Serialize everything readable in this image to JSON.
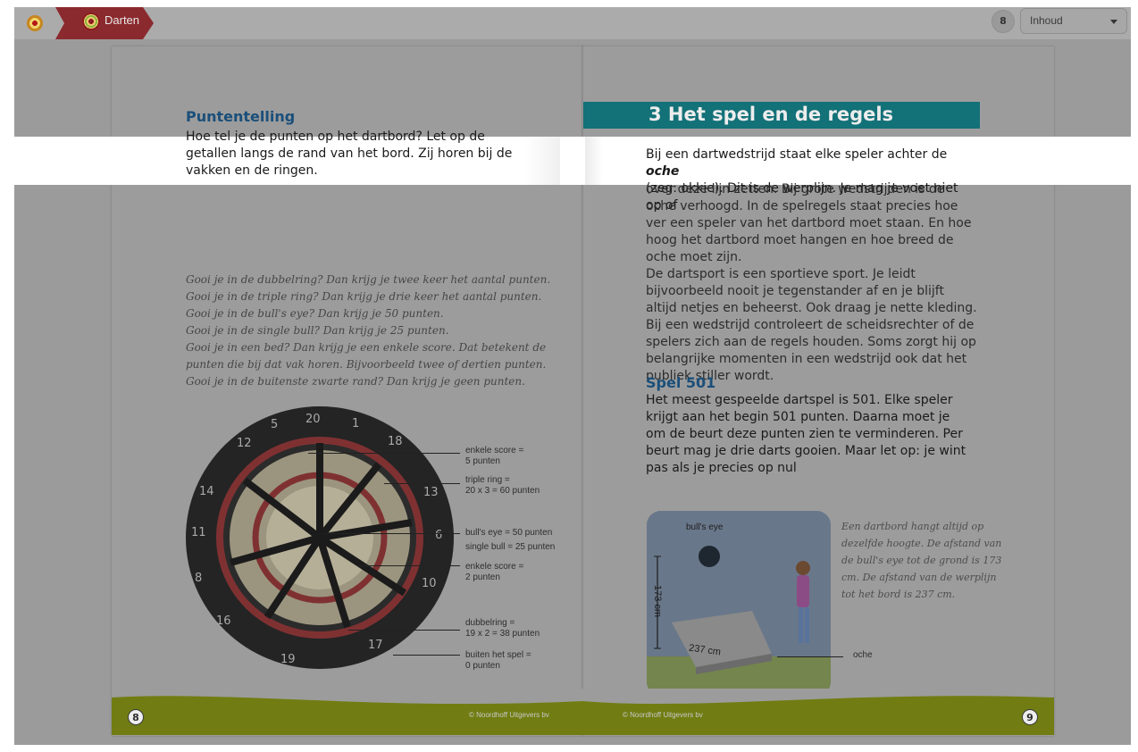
{
  "topbar": {
    "breadcrumb": "Darten",
    "page_number": "8",
    "toc_label": "Inhoud",
    "home_icon": "home-icon",
    "dartboard_icon": "dartboard-icon"
  },
  "colors": {
    "header_bar": "#ababab",
    "teal": "#137178",
    "blue_heading": "#1a4f7a",
    "footer_green": "#717d12"
  },
  "left_page": {
    "heading": "Puntentelling",
    "intro": "Hoe tel je de punten op het dartbord? Let op de getallen langs de rand van het bord. Zij horen bij de vakken en de ringen.",
    "rules": [
      "Gooi je in de dubbelring? Dan krijg je twee keer het aantal punten.",
      "Gooi je in de triple ring? Dan krijg je drie keer het aantal punten.",
      "Gooi je in de bull's eye? Dan krijg je 50 punten.",
      "Gooi je in de single bull? Dan krijg je 25 punten.",
      "Gooi je in een bed? Dan krijg je een enkele score. Dat betekent de punten die bij dat vak horen. Bijvoorbeeld twee of dertien punten.",
      "Gooi je in de buitenste zwarte rand? Dan krijg je geen punten."
    ],
    "dart_labels": {
      "l1a": "enkele score =",
      "l1b": "5 punten",
      "l2a": "triple ring =",
      "l2b": "20 x 3 = 60 punten",
      "l3": "bull's eye = 50 punten",
      "l4": "single bull = 25 punten",
      "l5a": "enkele score =",
      "l5b": "2 punten",
      "l6a": "dubbelring =",
      "l6b": "19 x 2 = 38 punten",
      "l7a": "buiten het spel =",
      "l7b": "0 punten"
    },
    "page_number": "8",
    "copyright": "© Noordhoff Uitgevers bv"
  },
  "right_page": {
    "chapter_title": "3  Het spel en de regels",
    "intro_before": "Bij een dartwedstrijd staat elke speler achter de ",
    "intro_term": "oche",
    "intro_after": "(zeg: okkie). Dit is de werplijn. Je mag je voet niet op of",
    "body_p1": "over deze lijn zetten. Bij grote wedstrijden is de oche verhoogd. In de spelregels staat precies hoe ver een speler van het dartbord moet staan. En hoe hoog het dartbord moet hangen en hoe breed de oche moet zijn.",
    "body_p2": "De dartsport is een sportieve sport. Je leidt bijvoorbeeld nooit je tegenstander af en je blijft altijd netjes en beheerst. Ook draag je nette kleding. Bij een wedstrijd controleert de scheidsrechter of de spelers zich aan de regels houden. Soms zorgt hij op belangrijke momenten in een wedstrijd ook dat het publiek stiller wordt.",
    "spel_heading": "Spel 501",
    "spel_text": "Het meest gespeelde dartspel is 501. Elke speler krijgt aan het begin 501 punten. Daarna moet je om de beurt deze punten zien te verminderen. Per beurt mag je drie darts gooien. Maar let op: je wint pas als je precies op nul",
    "illustration": {
      "bulls_eye": "bull's eye",
      "height": "173 cm",
      "distance": "237 cm",
      "oche": "oche"
    },
    "caption": "Een dartbord hangt altijd op dezelfde hoogte. De afstand van de bull's eye tot de grond is 173 cm. De afstand van de werplijn tot het bord is 237 cm.",
    "page_number": "9",
    "copyright": "© Noordhoff Uitgevers bv"
  }
}
